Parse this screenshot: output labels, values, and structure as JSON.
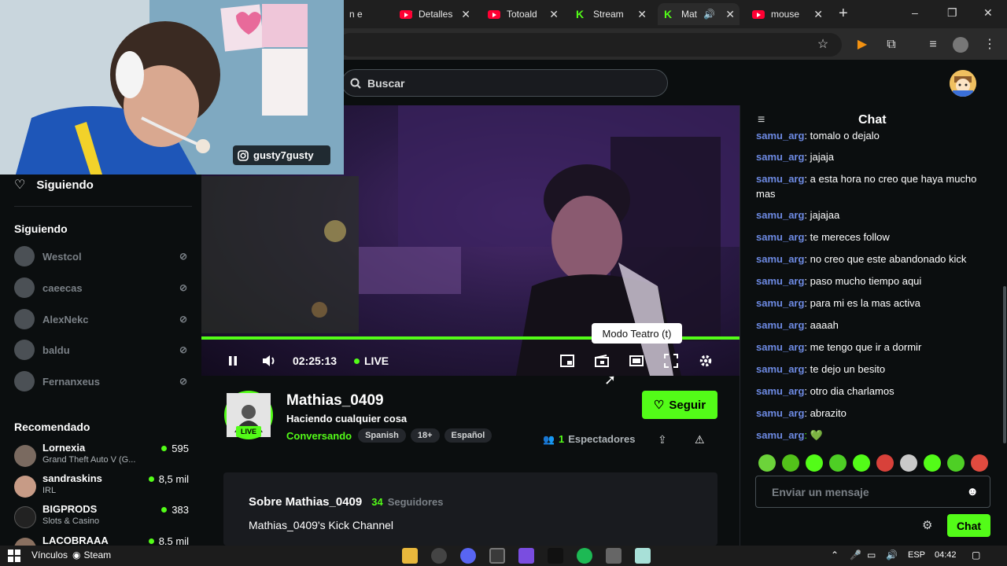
{
  "browser": {
    "tabs": [
      {
        "label": "n e",
        "type": "text"
      },
      {
        "label": "Detalles",
        "type": "youtube"
      },
      {
        "label": "Totoald",
        "type": "youtube"
      },
      {
        "label": "Stream",
        "type": "kick"
      },
      {
        "label": "Mat",
        "type": "kick"
      },
      {
        "label": "mouse",
        "type": "youtube"
      }
    ],
    "new_tab": "+",
    "window_controls": {
      "minimize": "–",
      "restore": "❐",
      "close": "✕"
    }
  },
  "site": {
    "search_placeholder": "Buscar"
  },
  "webcam": {
    "instagram_handle": "gusty7gusty"
  },
  "sidebar": {
    "following_nav": "Siguiendo",
    "following_heading": "Siguiendo",
    "following": [
      "Westcol",
      "caeecas",
      "AlexNekc",
      "baldu",
      "Fernanxeus"
    ],
    "recommended_heading": "Recomendado",
    "recommended": [
      {
        "name": "Lornexia",
        "category": "Grand Theft Auto V (G...",
        "viewers": "595"
      },
      {
        "name": "sandraskins",
        "category": "IRL",
        "viewers": "8,5 mil"
      },
      {
        "name": "BIGPRODS",
        "category": "Slots & Casino",
        "viewers": "383"
      },
      {
        "name": "LACOBRAAA",
        "category": "",
        "viewers": "8.5 mil"
      }
    ]
  },
  "player": {
    "time": "02:25:13",
    "live_label": "LIVE",
    "tooltip": "Modo Teatro (t)"
  },
  "channel": {
    "name": "Mathias_0409",
    "title": "Haciendo cualquier cosa",
    "category": "Conversando",
    "tags": [
      "Spanish",
      "18+",
      "Español"
    ],
    "live_badge": "LIVE",
    "follow_label": "Seguir",
    "viewers_count": "1",
    "viewers_label": "Espectadores",
    "about_heading": "Sobre Mathias_0409",
    "followers_count": "34",
    "followers_label": "Seguidores",
    "description": "Mathias_0409's Kick Channel"
  },
  "chat": {
    "title": "Chat",
    "messages": [
      {
        "user": "samu_arg",
        "text": ": tomalo o dejalo"
      },
      {
        "user": "samu_arg",
        "text": ": jajaja"
      },
      {
        "user": "samu_arg",
        "text": ": a esta hora no creo que haya mucho mas"
      },
      {
        "user": "samu_arg",
        "text": ": jajajaa"
      },
      {
        "user": "samu_arg",
        "text": ": te mereces follow"
      },
      {
        "user": "samu_arg",
        "text": ": no creo que este abandonado kick"
      },
      {
        "user": "samu_arg",
        "text": ": paso mucho tiempo aqui"
      },
      {
        "user": "samu_arg",
        "text": ": para mi es la mas activa"
      },
      {
        "user": "samu_arg",
        "text": ": aaaah"
      },
      {
        "user": "samu_arg",
        "text": ": me tengo que ir a dormir"
      },
      {
        "user": "samu_arg",
        "text": ": te dejo un besito"
      },
      {
        "user": "samu_arg",
        "text": ": otro dia charlamos"
      },
      {
        "user": "samu_arg",
        "text": ": abrazito"
      },
      {
        "user": "samu_arg",
        "text": ": 💚"
      }
    ],
    "input_placeholder": "Enviar un mensaje",
    "send_label": "Chat"
  },
  "taskbar": {
    "links_label": "Vínculos",
    "steam_label": "Steam",
    "language": "ESP",
    "clock": "04:42"
  },
  "colors": {
    "accent": "#53fc18",
    "username": "#6d8ae3",
    "background": "#0b0e0f"
  }
}
